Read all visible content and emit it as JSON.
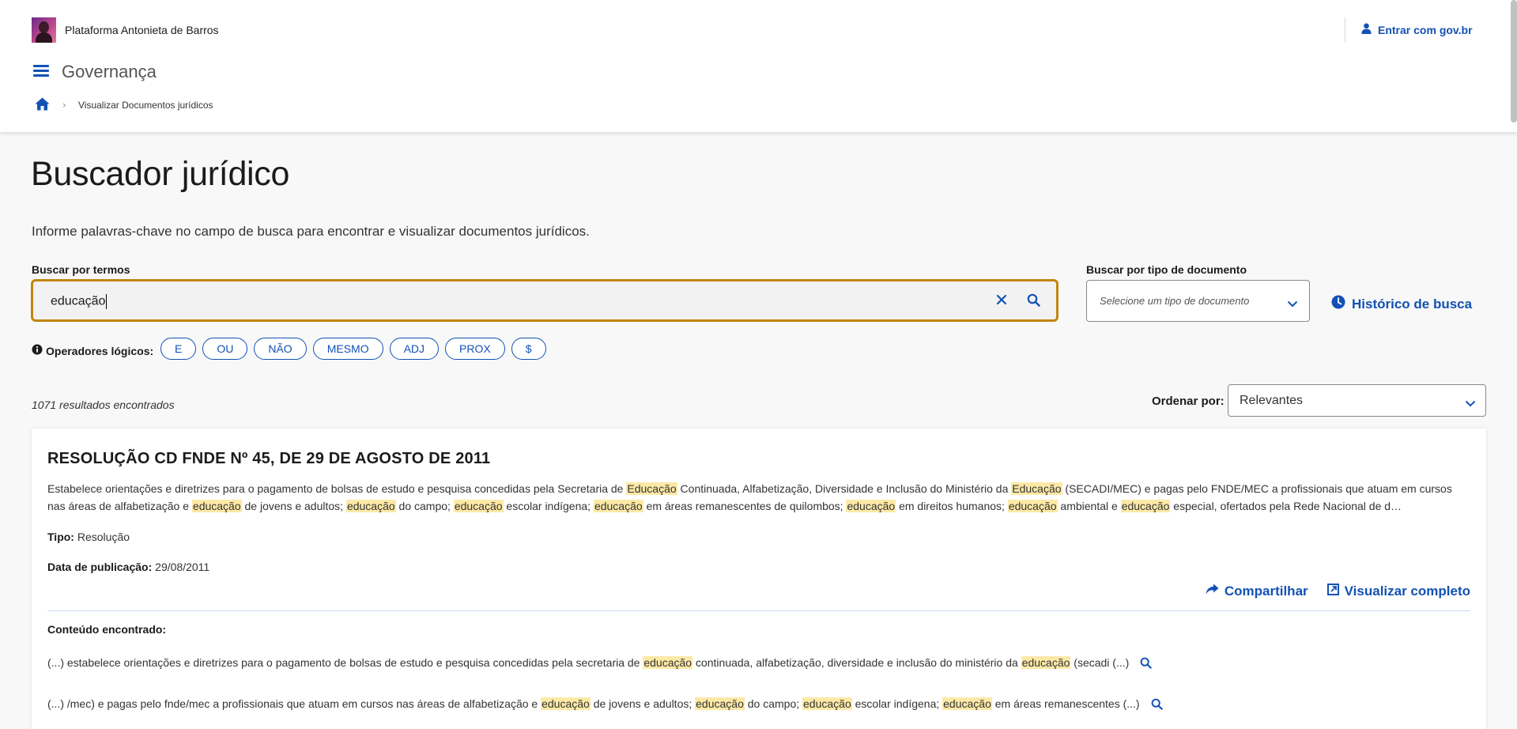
{
  "header": {
    "brand": "Plataforma Antonieta de Barros",
    "login_prefix": "Entrar com ",
    "login_strong": "gov.br",
    "system_title": "Governança",
    "breadcrumb_current": "Visualizar Documentos jurídicos"
  },
  "main": {
    "title": "Buscador jurídico",
    "description": "Informe palavras-chave no campo de busca para encontrar e visualizar documentos jurídicos.",
    "search_label": "Buscar por termos",
    "search_value": "educação",
    "doc_type_label": "Buscar por tipo de documento",
    "doc_type_placeholder": "Selecione um tipo de documento",
    "history_label": "Histórico de busca",
    "operators_label": "Operadores lógicos:",
    "operators": [
      "E",
      "OU",
      "NÃO",
      "MESMO",
      "ADJ",
      "PROX",
      "$"
    ],
    "results_count": "1071 resultados encontrados",
    "order_label": "Ordenar por:",
    "order_value": "Relevantes"
  },
  "result": {
    "title": "RESOLUÇÃO CD FNDE Nº 45, DE 29 DE AGOSTO DE 2011",
    "description_parts": [
      {
        "t": "Estabelece orientações e diretrizes para o pagamento de bolsas de estudo e pesquisa concedidas pela Secretaria de "
      },
      {
        "t": "Educação",
        "hl": true
      },
      {
        "t": " Continuada, Alfabetização, Diversidade e Inclusão do Ministério da "
      },
      {
        "t": "Educação",
        "hl": true
      },
      {
        "t": " (SECADI/MEC) e pagas pelo FNDE/MEC a profissionais que atuam em cursos nas áreas de alfabetização e "
      },
      {
        "t": "educação",
        "hl": true
      },
      {
        "t": " de jovens e adultos; "
      },
      {
        "t": "educação",
        "hl": true
      },
      {
        "t": " do campo; "
      },
      {
        "t": "educação",
        "hl": true
      },
      {
        "t": " escolar indígena; "
      },
      {
        "t": "educação",
        "hl": true
      },
      {
        "t": " em áreas remanescentes de quilombos; "
      },
      {
        "t": "educação",
        "hl": true
      },
      {
        "t": " em direitos humanos; "
      },
      {
        "t": "educação",
        "hl": true
      },
      {
        "t": " ambiental e "
      },
      {
        "t": "educação",
        "hl": true
      },
      {
        "t": " especial, ofertados pela Rede Nacional de d…"
      }
    ],
    "type_label": "Tipo:",
    "type_value": "Resolução",
    "date_label": "Data de publicação:",
    "date_value": "29/08/2011",
    "share_label": "Compartilhar",
    "view_label": "Visualizar completo",
    "found_label": "Conteúdo encontrado:",
    "snippets": [
      [
        {
          "t": "(...) estabelece orientações e diretrizes para o pagamento de bolsas de estudo e pesquisa concedidas pela secretaria de "
        },
        {
          "t": "educação",
          "hl": true
        },
        {
          "t": " continuada, alfabetização, diversidade e inclusão do ministério da "
        },
        {
          "t": "educação",
          "hl": true
        },
        {
          "t": " (secadi (...)"
        }
      ],
      [
        {
          "t": "(...) /mec) e pagas pelo fnde/mec a profissionais que atuam em cursos nas áreas de alfabetização e "
        },
        {
          "t": "educação",
          "hl": true
        },
        {
          "t": " de jovens e adultos; "
        },
        {
          "t": "educação",
          "hl": true
        },
        {
          "t": " do campo; "
        },
        {
          "t": "educação",
          "hl": true
        },
        {
          "t": " escolar indígena; "
        },
        {
          "t": "educação",
          "hl": true
        },
        {
          "t": " em áreas remanescentes (...)"
        }
      ]
    ]
  },
  "colors": {
    "primary": "#1351b4",
    "focus_border": "#c2850c",
    "highlight": "#fde9a6"
  },
  "icons": {
    "login": "user-icon",
    "menu": "hamburger-menu-icon",
    "home": "home-icon",
    "clear": "close-icon",
    "search": "search-icon",
    "history": "clock-icon",
    "info": "info-icon",
    "share": "share-icon",
    "external": "external-link-icon"
  }
}
